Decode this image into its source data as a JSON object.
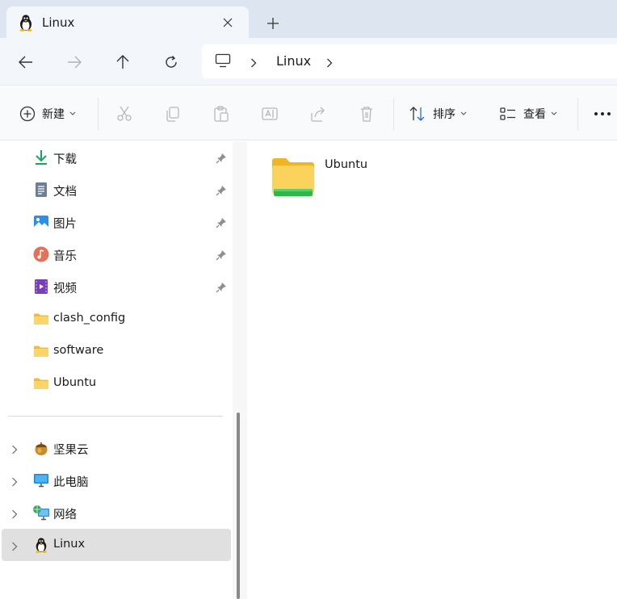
{
  "tab": {
    "title": "Linux",
    "icon": "tux-icon"
  },
  "nav": {
    "back": "arrow-left-icon",
    "forward": "arrow-right-icon",
    "up": "arrow-up-icon",
    "refresh": "refresh-icon",
    "breadcrumb": [
      "Linux"
    ]
  },
  "commands": {
    "new_label": "新建",
    "sort_label": "排序",
    "view_label": "查看"
  },
  "sidebar": {
    "quick_access": [
      {
        "label": "下载",
        "icon": "download-icon",
        "pinned": true
      },
      {
        "label": "文档",
        "icon": "document-icon",
        "pinned": true
      },
      {
        "label": "图片",
        "icon": "pictures-icon",
        "pinned": true
      },
      {
        "label": "音乐",
        "icon": "music-icon",
        "pinned": true
      },
      {
        "label": "视频",
        "icon": "video-icon",
        "pinned": true
      },
      {
        "label": "clash_config",
        "icon": "folder-icon",
        "pinned": false
      },
      {
        "label": "software",
        "icon": "folder-icon",
        "pinned": false
      },
      {
        "label": "Ubuntu",
        "icon": "folder-icon",
        "pinned": false
      }
    ],
    "locations": [
      {
        "label": "坚果云",
        "icon": "nutstore-icon"
      },
      {
        "label": "此电脑",
        "icon": "computer-icon"
      },
      {
        "label": "网络",
        "icon": "network-icon"
      },
      {
        "label": "Linux",
        "icon": "tux-icon",
        "selected": true
      }
    ]
  },
  "content": {
    "items": [
      {
        "name": "Ubuntu",
        "type": "folder"
      }
    ]
  },
  "colors": {
    "tabbar_bg": "#dde6f0",
    "navbar_bg": "#f3f6fa",
    "folder_yellow": "#f8c94a",
    "linux_green": "#2fb84a",
    "selected_bg": "#e0e0e0"
  }
}
